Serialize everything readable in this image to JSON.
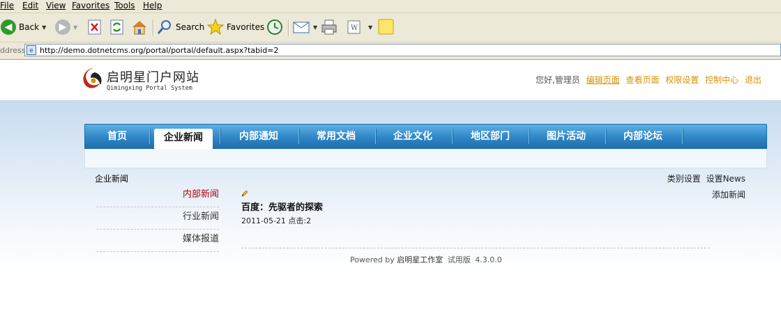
{
  "browser": {
    "menu": [
      {
        "label": "File"
      },
      {
        "label": "Edit"
      },
      {
        "label": "View"
      },
      {
        "label": "Favorites"
      },
      {
        "label": "Tools"
      },
      {
        "label": "Help"
      }
    ],
    "toolbar": {
      "back_label": "Back",
      "search_label": "Search",
      "favorites_label": "Favorites"
    },
    "address": {
      "label": "ddress",
      "url": "http://demo.dotnetcms.org/portal/portal/default.aspx?tabid=2"
    }
  },
  "site": {
    "title": "启明星门户网站",
    "subtitle": "Qimingxing Portal System",
    "greeting": "您好,管理员",
    "user_links": [
      "编辑页面",
      "查看页面",
      "权限设置",
      "控制中心",
      "退出"
    ],
    "nav": [
      "首页",
      "企业新闻",
      "内部通知",
      "常用文档",
      "企业文化",
      "地区部门",
      "图片活动",
      "内部论坛"
    ],
    "active_nav": "企业新闻"
  },
  "content": {
    "section_title": "企业新闻",
    "category_settings": "类别设置",
    "settings_news": "设置News",
    "add_news": "添加新闻",
    "sidebar": [
      "内部新闻",
      "行业新闻",
      "媒体报道"
    ],
    "news": {
      "title": "百度：先驱者的探索",
      "meta": "2011-05-21 点击:2"
    }
  },
  "footer": {
    "powered_by": "Powered by",
    "studio": "启明星工作室",
    "edition": "试用版",
    "version": "4.3.0.0"
  },
  "colors": {
    "nav_blue": "#2f86c6",
    "link_orange": "#d99000",
    "active_red": "#b3000e"
  }
}
